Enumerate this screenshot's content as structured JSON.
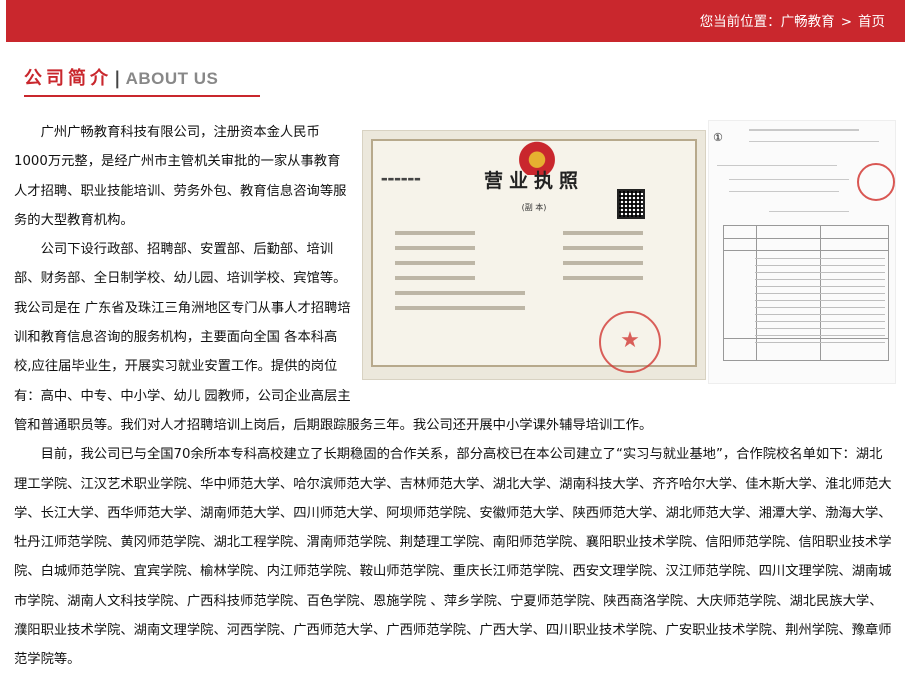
{
  "breadcrumb": {
    "prefix": "您当前位置：",
    "home": "广畅教育",
    "separator": ">",
    "current": "首页"
  },
  "section": {
    "title_cn": "公司简介",
    "divider": "|",
    "title_en": "ABOUT US"
  },
  "images": {
    "license": {
      "title": "营业执照",
      "subtitle": "(副 本)",
      "seal_text": "★"
    },
    "notice": {
      "number": "①"
    }
  },
  "content": {
    "p1": "广州广畅教育科技有限公司，注册资本金人民币1000万元整，是经广州市主管机关审批的一家从事教育人才招聘、职业技能培训、劳务外包、教育信息咨询等服务的大型教育机构。",
    "p2": "公司下设行政部、招聘部、安置部、后勤部、培训部、财务部、全日制学校、幼儿园、培训学校、宾馆等。我公司是在 广东省及珠江三角洲地区专门从事人才招聘培训和教育信息咨询的服务机构，主要面向全国 各本科高校,应往届毕业生，开展实习就业安置工作。提供的岗位有：高中、中专、中小学、幼儿 园教师，公司企业高层主管和普通职员等。我们对人才招聘培训上岗后，后期跟踪服务三年。我公司还开展中小学课外辅导培训工作。",
    "p3": "目前，我公司已与全国70余所本专科高校建立了长期稳固的合作关系，部分高校已在本公司建立了“实习与就业基地”，合作院校名单如下：湖北理工学院、江汉艺术职业学院、华中师范大学、哈尔滨师范大学、吉林师范大学、湖北大学、湖南科技大学、齐齐哈尔大学、佳木斯大学、淮北师范大学、长江大学、西华师范大学、湖南师范大学、四川师范大学、阿坝师范学院、安徽师范大学、陕西师范大学、湖北师范大学、湘潭大学、渤海大学、牡丹江师范学院、黄冈师范学院、湖北工程学院、渭南师范学院、荆楚理工学院、南阳师范学院、襄阳职业技术学院、信阳师范学院、信阳职业技术学院、白城师范学院、宜宾学院、榆林学院、内江师范学院、鞍山师范学院、重庆长江师范学院、西安文理学院、汉江师范学院、四川文理学院、湖南城市学院、湖南人文科技学院、广西科技师范学院、百色学院、恩施学院 、萍乡学院、宁夏师范学院、陕西商洛学院、大庆师范学院、湖北民族大学、濮阳职业技术学院、湖南文理学院、河西学院、广西师范大学、广西师范学院、广西大学、四川职业技术学院、广安职业技术学院、荆州学院、豫章师范学院等。"
  }
}
